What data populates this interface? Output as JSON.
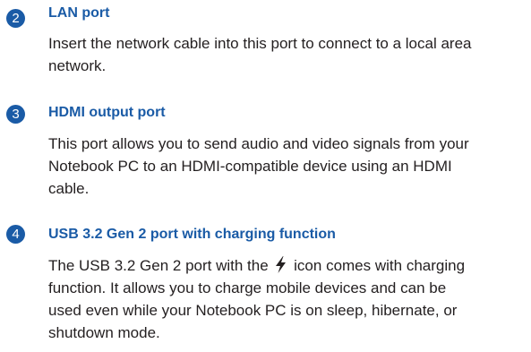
{
  "items": [
    {
      "number": "2",
      "title": "LAN port",
      "lines": [
        "Insert the network cable into this port to connect to a local area",
        "network."
      ]
    },
    {
      "number": "3",
      "title": "HDMI output port",
      "lines": [
        "This port allows you to send audio and video signals from your",
        "Notebook PC to an HDMI-compatible device using an HDMI",
        "cable."
      ]
    },
    {
      "number": "4",
      "title": "USB 3.2 Gen 2 port with charging function",
      "line1_before_icon": "The USB 3.2 Gen 2 port with the",
      "icon": "lightning-bolt-icon",
      "line1_after_icon": "icon comes with charging",
      "lines": [
        "function. It allows you to charge mobile devices and can be",
        "used even while your Notebook PC is on sleep, hibernate, or",
        "shutdown mode."
      ]
    }
  ],
  "colors": {
    "accent": "#1a5ba6",
    "text": "#231f20"
  }
}
